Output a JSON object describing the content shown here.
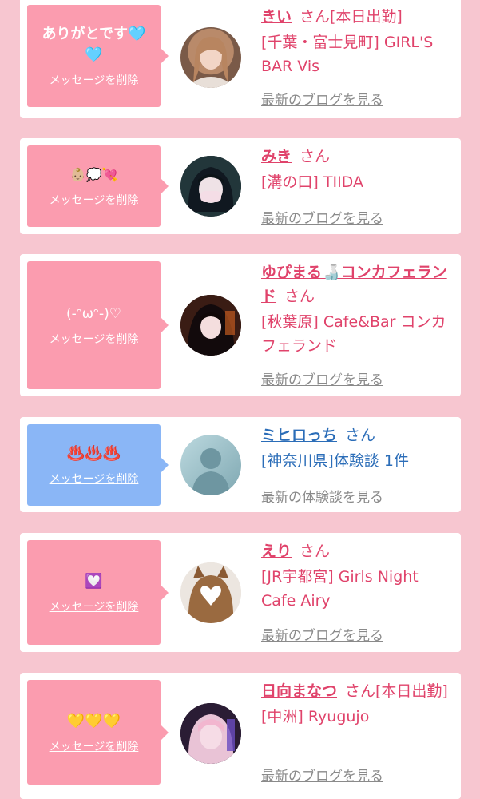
{
  "colors": {
    "page_bg": "#f7c6d0",
    "bubble_pink": "#fb9caf",
    "bubble_blue": "#8ab6f6",
    "text_pink": "#e0436b",
    "text_blue": "#2b6db8",
    "link_gray": "#8a8a8a"
  },
  "entries": [
    {
      "message": "ありがとです🩵🩵",
      "delete_label": "メッセージを削除",
      "name": "きい",
      "suffix": "さん[本日出勤]",
      "shop": "[千葉・富士見町] GIRL'S BAR Vis",
      "more_label": "最新のブログを見る",
      "avatar": "photo"
    },
    {
      "message": "👶🏼💭💘",
      "delete_label": "メッセージを削除",
      "name": "みき",
      "suffix": "さん",
      "shop": "[溝の口] TIIDA",
      "more_label": "最新のブログを見る",
      "avatar": "photo"
    },
    {
      "message": "(-ᵔωᵔ-)♡",
      "delete_label": "メッセージを削除",
      "name": "ゆぴまる🍶コンカフェランド",
      "suffix": "さん",
      "shop": "[秋葉原] Cafe&Bar コンカフェランド",
      "more_label": "最新のブログを見る",
      "avatar": "photo"
    },
    {
      "message": "♨️♨️♨️",
      "delete_label": "メッセージを削除",
      "name": "ミヒロっち",
      "suffix": "さん",
      "shop": "[神奈川県]体験談 1件",
      "more_label": "最新の体験談を見る",
      "avatar": "no photo"
    },
    {
      "message": "💟",
      "delete_label": "メッセージを削除",
      "name": "えり",
      "suffix": "さん",
      "shop": "[JR宇都宮] Girls Night Cafe Airy",
      "more_label": "最新のブログを見る",
      "avatar": "photo"
    },
    {
      "message": "💛💛💛",
      "delete_label": "メッセージを削除",
      "name": "日向まなつ",
      "suffix": "さん[本日出勤]",
      "shop": "[中洲] Ryugujo",
      "more_label": "最新のブログを見る",
      "avatar": "photo"
    }
  ]
}
